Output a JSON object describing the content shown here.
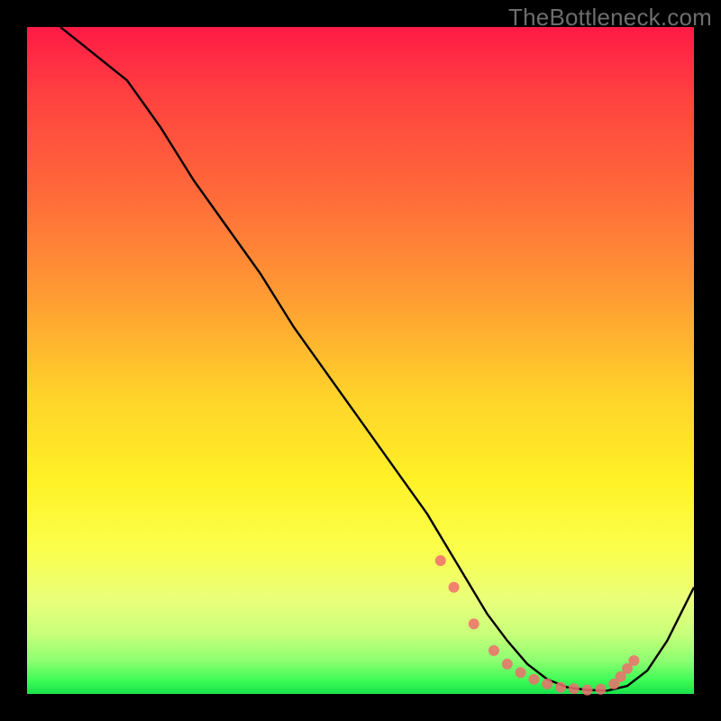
{
  "attribution": "TheBottleneck.com",
  "chart_data": {
    "type": "line",
    "title": "",
    "xlabel": "",
    "ylabel": "",
    "xlim": [
      0,
      100
    ],
    "ylim": [
      0,
      100
    ],
    "series": [
      {
        "name": "bottleneck-curve",
        "color": "#000000",
        "x": [
          5,
          10,
          15,
          20,
          25,
          30,
          35,
          40,
          45,
          50,
          55,
          60,
          63,
          66,
          69,
          72,
          75,
          78,
          81,
          84,
          87,
          90,
          93,
          96,
          100
        ],
        "y": [
          100,
          96,
          92,
          85,
          77,
          70,
          63,
          55,
          48,
          41,
          34,
          27,
          22,
          17,
          12,
          8,
          4.5,
          2.2,
          1,
          0.6,
          0.5,
          1.2,
          3.5,
          8,
          16
        ]
      }
    ],
    "markers": {
      "name": "highlight-dots",
      "color": "#ee6d6d",
      "x": [
        62,
        64,
        67,
        70,
        72,
        74,
        76,
        78,
        80,
        82,
        84,
        86,
        88,
        89,
        90,
        91
      ],
      "y": [
        20,
        16,
        10.5,
        6.5,
        4.5,
        3.2,
        2.2,
        1.5,
        1.0,
        0.8,
        0.6,
        0.7,
        1.5,
        2.6,
        3.8,
        5.0
      ]
    },
    "gradient_stops": [
      {
        "pos": 0.0,
        "color": "#ff1a46"
      },
      {
        "pos": 0.25,
        "color": "#ff6a3a"
      },
      {
        "pos": 0.55,
        "color": "#ffd22a"
      },
      {
        "pos": 0.78,
        "color": "#fbff4a"
      },
      {
        "pos": 0.95,
        "color": "#8dff71"
      },
      {
        "pos": 1.0,
        "color": "#18e24e"
      }
    ]
  }
}
